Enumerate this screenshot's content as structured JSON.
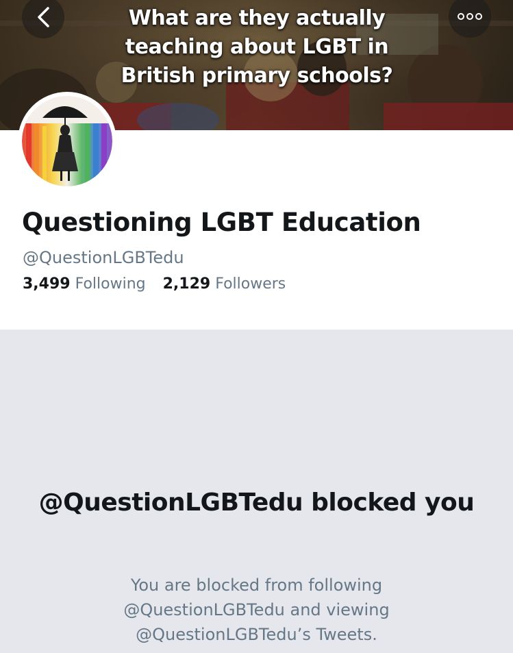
{
  "banner": {
    "title_lines": [
      "What are they actually",
      "teaching about LGBT in",
      "British primary schools?"
    ]
  },
  "nav": {
    "back_icon": "chevron-left-icon",
    "more_icon": "more-options-icon"
  },
  "profile": {
    "display_name": "Questioning LGBT Education",
    "handle": "@QuestionLGBTedu",
    "following_count": "3,499",
    "following_label": "Following",
    "followers_count": "2,129",
    "followers_label": "Followers"
  },
  "blocked": {
    "title": "@QuestionLGBTedu blocked you",
    "description": "You are blocked from following @QuestionLGBTedu and viewing @QuestionLGBTedu’s Tweets."
  },
  "colors": {
    "primary_text": "#14171a",
    "secondary_text": "#657786",
    "page_background": "#e6e7ec",
    "profile_background": "#ffffff"
  }
}
